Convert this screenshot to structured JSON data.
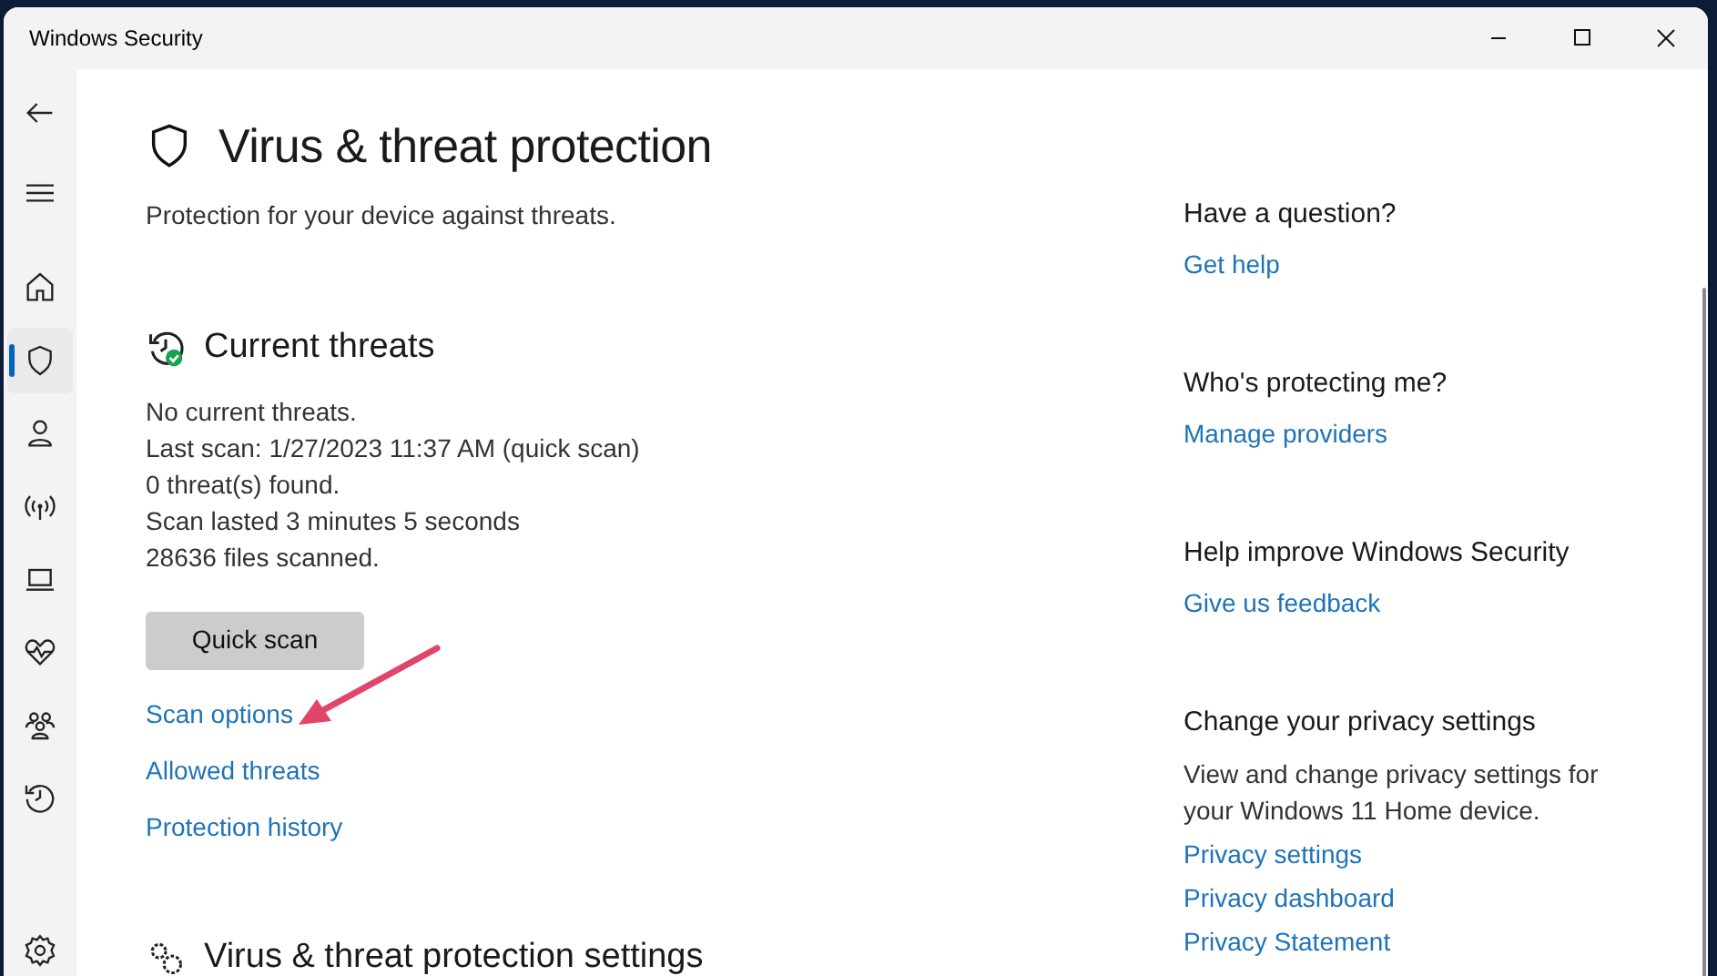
{
  "window": {
    "title": "Windows Security"
  },
  "nav": [
    {
      "kind": "back",
      "selected": false
    },
    {
      "kind": "menu",
      "selected": false
    },
    {
      "kind": "home",
      "selected": false
    },
    {
      "kind": "shield",
      "selected": true
    },
    {
      "kind": "account",
      "selected": false
    },
    {
      "kind": "network",
      "selected": false
    },
    {
      "kind": "app",
      "selected": false
    },
    {
      "kind": "health",
      "selected": false
    },
    {
      "kind": "family",
      "selected": false
    },
    {
      "kind": "history",
      "selected": false
    },
    {
      "kind": "settings",
      "selected": false
    }
  ],
  "page": {
    "title": "Virus & threat protection",
    "subtitle": "Protection for your device against threats."
  },
  "current_threats": {
    "title": "Current threats",
    "lines": [
      "No current threats.",
      "Last scan: 1/27/2023 11:37 AM (quick scan)",
      "0 threat(s) found.",
      "Scan lasted 3 minutes 5 seconds",
      "28636 files scanned."
    ],
    "button": "Quick scan",
    "links": [
      "Scan options",
      "Allowed threats",
      "Protection history"
    ]
  },
  "next_section": {
    "title": "Virus & threat protection settings"
  },
  "side_groups": [
    {
      "heading": "Have a question?",
      "links": [
        "Get help"
      ]
    },
    {
      "heading": "Who's protecting me?",
      "links": [
        "Manage providers"
      ]
    },
    {
      "heading": "Help improve Windows Security",
      "links": [
        "Give us feedback"
      ]
    },
    {
      "heading": "Change your privacy settings",
      "description": "View and change privacy settings for your Windows 11 Home device.",
      "links": [
        "Privacy settings",
        "Privacy dashboard",
        "Privacy Statement"
      ]
    }
  ]
}
